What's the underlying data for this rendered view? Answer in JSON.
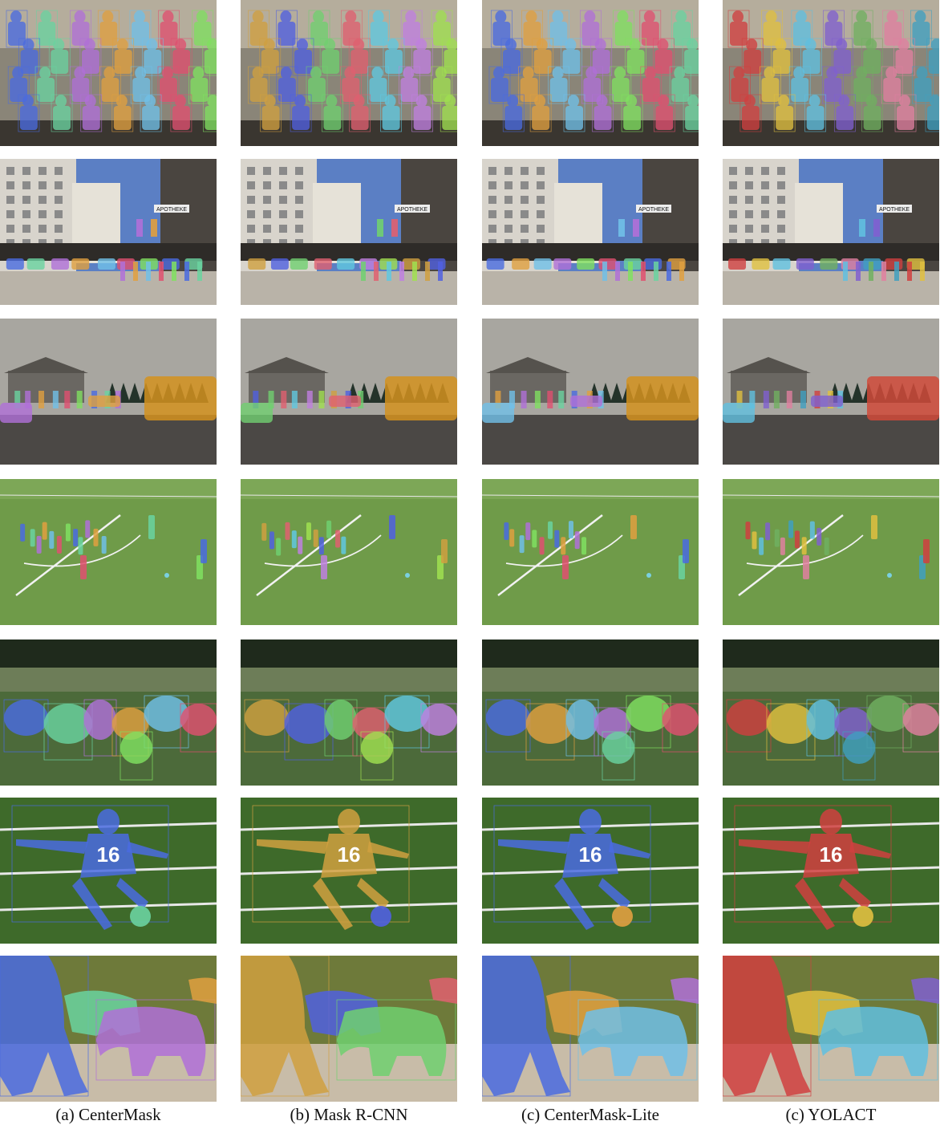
{
  "columns": [
    {
      "caption": "(a) CenterMask"
    },
    {
      "caption": "(b) Mask R-CNN"
    },
    {
      "caption": "(c) CenterMask-Lite"
    },
    {
      "caption": "(c) YOLACT"
    }
  ],
  "rows": [
    {
      "scene": "group-photo",
      "text": ""
    },
    {
      "scene": "street",
      "text": "APOTHEKE"
    },
    {
      "scene": "bus-street",
      "text": ""
    },
    {
      "scene": "soccer-field",
      "text": ""
    },
    {
      "scene": "sheep",
      "text": ""
    },
    {
      "scene": "soccer-player",
      "text": "16"
    },
    {
      "scene": "elephants",
      "text": ""
    }
  ],
  "mask_colors": {
    "col0": [
      "#4a6be0",
      "#6ad3a0",
      "#b070d8",
      "#e0a040",
      "#70c0e8",
      "#e05070",
      "#80e060"
    ],
    "col1": [
      "#d0a040",
      "#5060e0",
      "#70d070",
      "#e06070",
      "#60c8e0",
      "#c080e0",
      "#a0e050"
    ],
    "col2": [
      "#4a6be0",
      "#e0a040",
      "#70c0e8",
      "#b070d8",
      "#80e060",
      "#e05070",
      "#6ad3a0"
    ],
    "col3": [
      "#d04040",
      "#e0c040",
      "#60c0e0",
      "#8060d0",
      "#70b060",
      "#e080a0",
      "#40a0c0"
    ]
  }
}
